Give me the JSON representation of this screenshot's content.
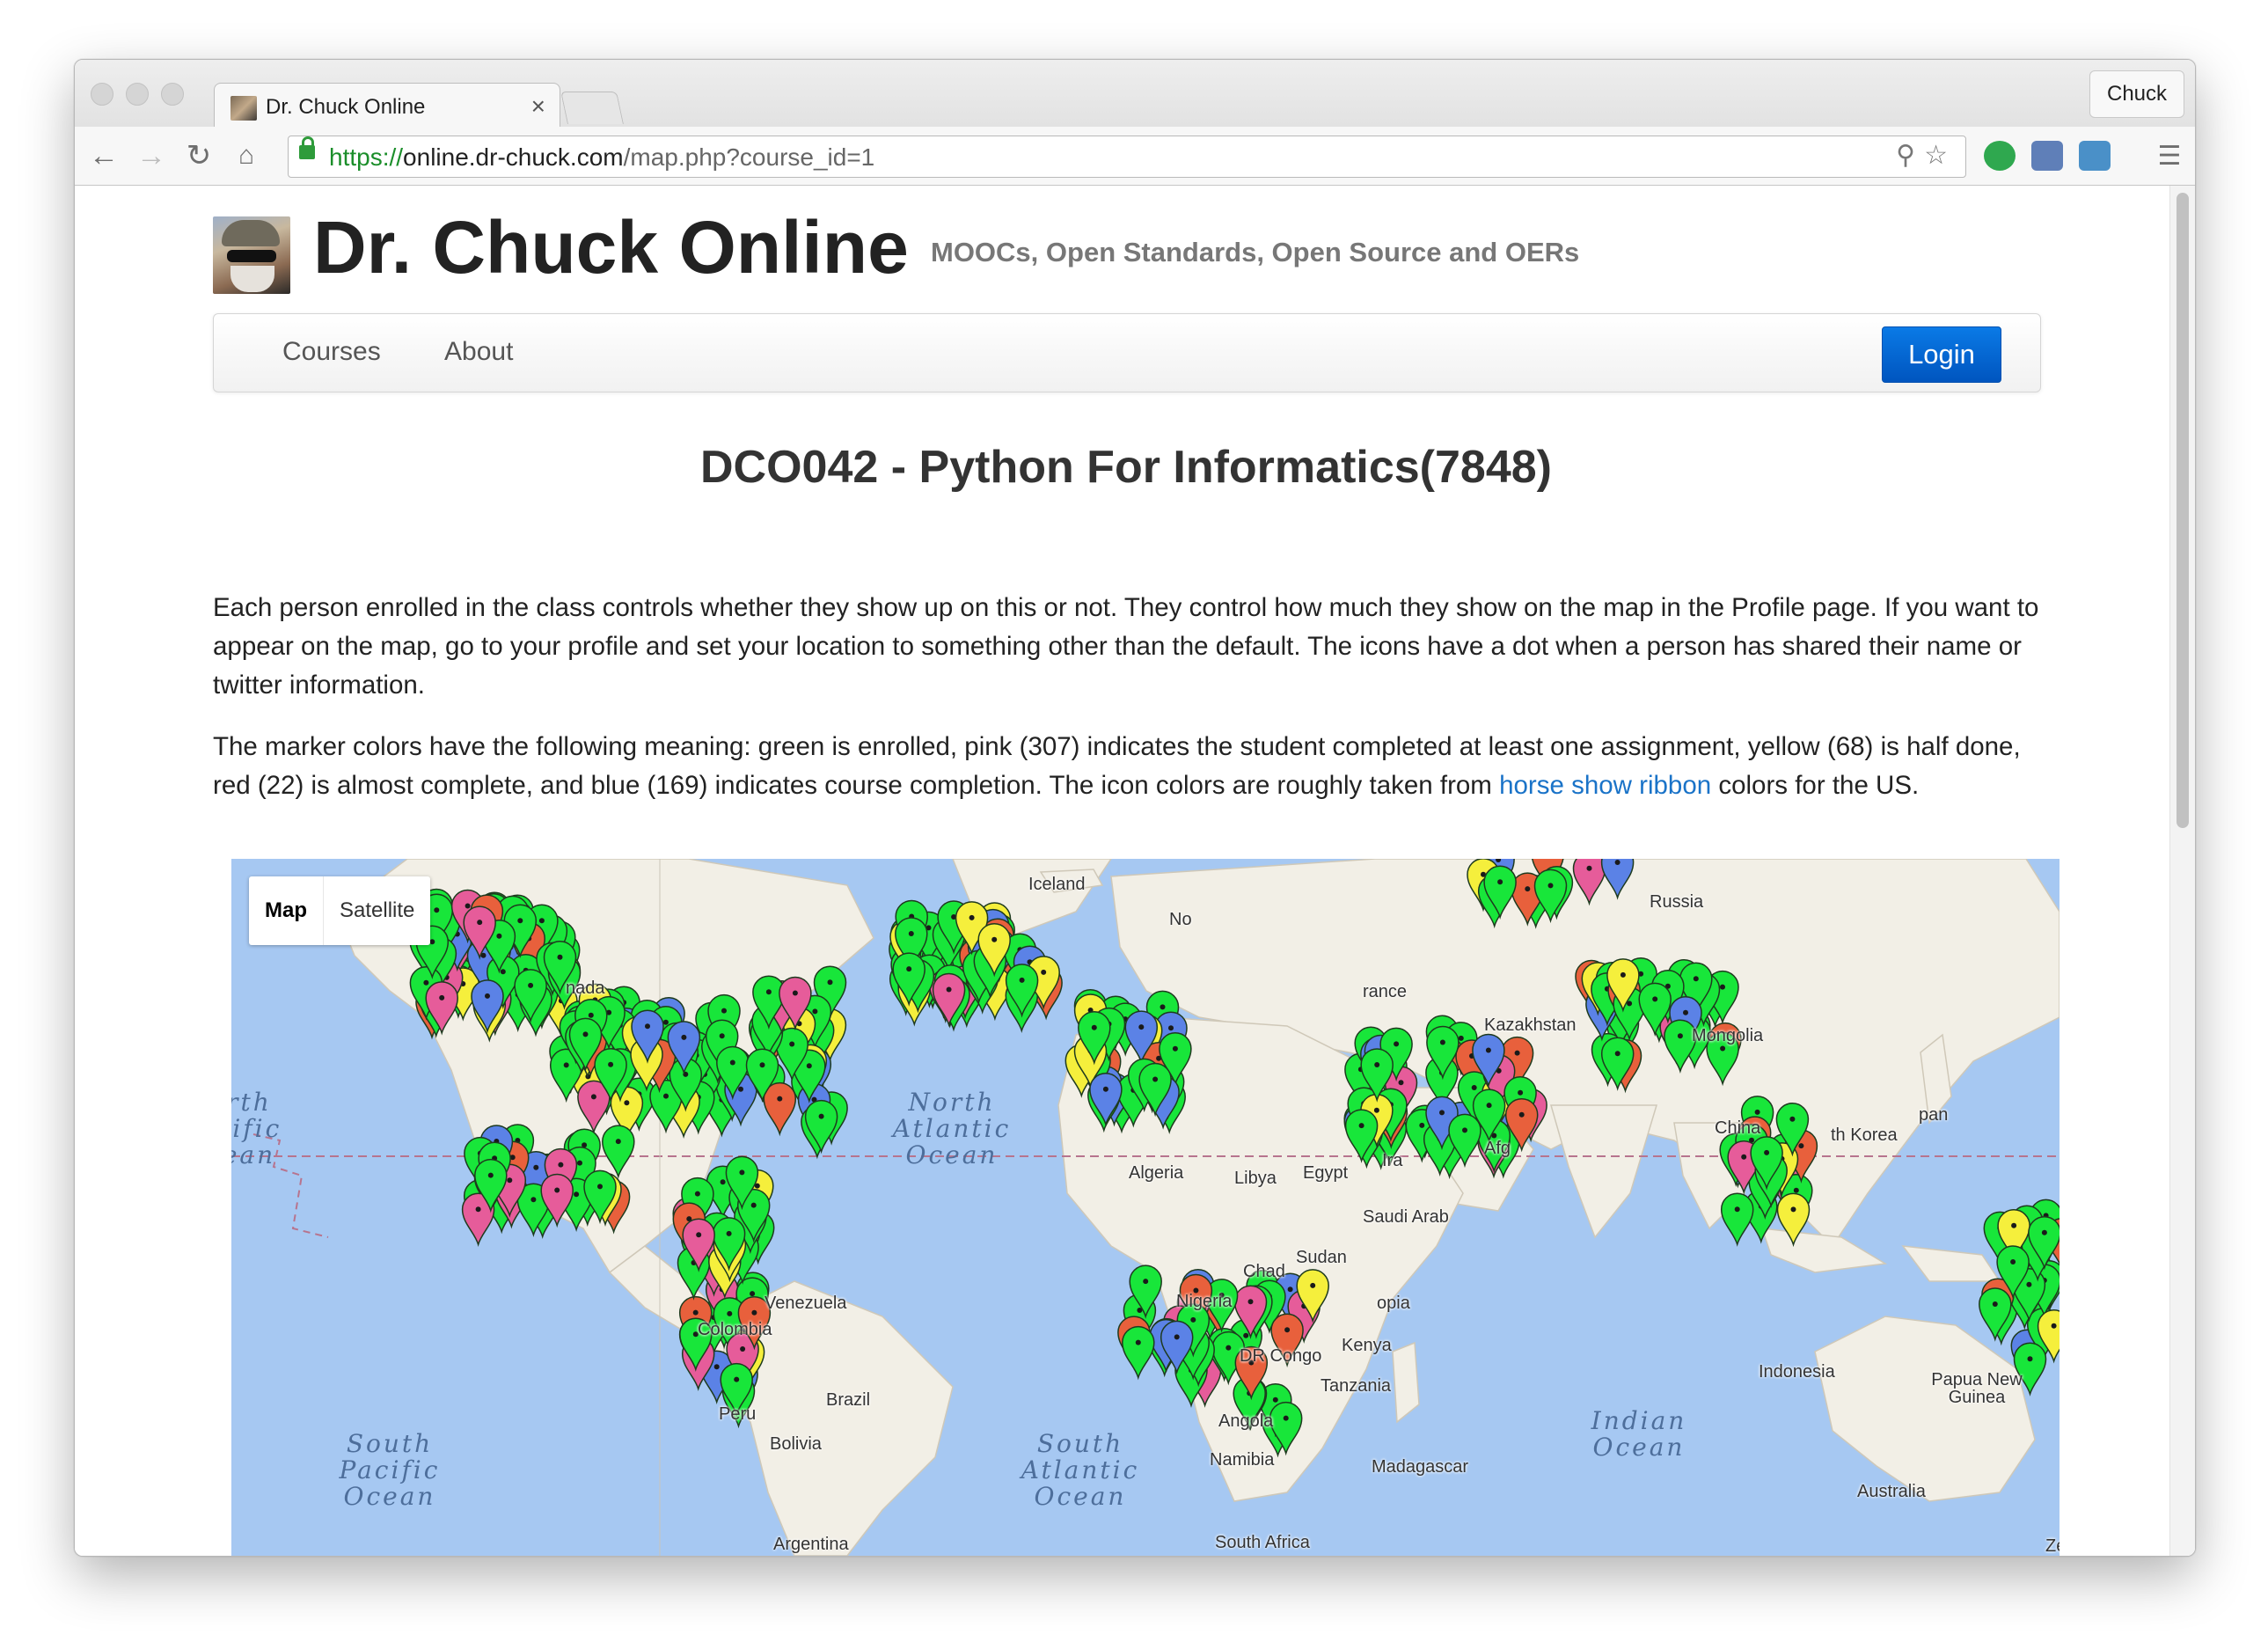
{
  "browser": {
    "tab_title": "Dr. Chuck Online",
    "tab_close": "×",
    "profile_name": "Chuck",
    "url_scheme": "https://",
    "url_host": "online.dr-chuck.com",
    "url_path": "/map.php?course_id=1",
    "nav_icons": {
      "back": "back-arrow-icon",
      "forward": "forward-arrow-icon",
      "reload": "reload-icon",
      "home": "home-icon"
    }
  },
  "site": {
    "title": "Dr. Chuck Online",
    "tagline": "MOOCs, Open Standards, Open Source and OERs"
  },
  "nav": {
    "items": [
      {
        "label": "Courses"
      },
      {
        "label": "About"
      }
    ],
    "login_label": "Login"
  },
  "course": {
    "title": "DCO042 - Python For Informatics(7848)"
  },
  "description": {
    "p1": "Each person enrolled in the class controls whether they show up on this or not. They control how much they show on the map in the Profile page. If you want to appear on the map, go to your profile and set your location to something other than the default. The icons have a dot when a person has shared their name or twitter information.",
    "p2_before": "The marker colors have the following meaning: green is enrolled, pink (307) indicates the student completed at least one assignment, yellow (68) is half done, red (22) is almost complete, and blue (169) indicates course completion. The icon colors are roughly taken from ",
    "p2_link": "horse show ribbon",
    "p2_after": " colors for the US."
  },
  "map": {
    "type_buttons": [
      {
        "label": "Map",
        "active": true
      },
      {
        "label": "Satellite",
        "active": false
      }
    ],
    "labels": {
      "iceland": "Iceland",
      "russia": "Russia",
      "kazakhstan": "Kazakhstan",
      "mongolia": "Mongolia",
      "china": "China",
      "algeria": "Algeria",
      "libya": "Libya",
      "egypt": "Egypt",
      "saudi": "Saudi Arab",
      "sudan": "Sudan",
      "chad": "Chad",
      "nigeria": "Nigeria",
      "ethiopia": "opia",
      "kenya": "Kenya",
      "drcongo": "DR Congo",
      "tanzania": "Tanzania",
      "angola": "Angola",
      "namibia": "Namibia",
      "madagascar": "Madagascar",
      "southafrica": "South Africa",
      "venezuela": "Venezuela",
      "colombia": "Colombia",
      "brazil": "Brazil",
      "peru": "Peru",
      "bolivia": "Bolivia",
      "argentina": "Argentina",
      "canada": "nada",
      "indonesia": "Indonesia",
      "png": "Papua New Guinea",
      "australia": "Australia",
      "japan": "pan",
      "korea": "th Korea",
      "afghanistan": "Afg",
      "iran": "Ira",
      "france": "rance",
      "norway": "No",
      "zoom": "Ze"
    },
    "oceans": {
      "north_atlantic": "North Atlantic Ocean",
      "south_atlantic": "South Atlantic Ocean",
      "south_pacific": "South Pacific Ocean",
      "north_pacific": "rth cific ean",
      "indian": "Indian Ocean"
    },
    "colors": {
      "water": "#a6c8f2",
      "land": "#f2efe6",
      "green_marker": "#18e63a",
      "pink_marker": "#e65c9a",
      "yellow_marker": "#f5ef3c",
      "red_marker": "#e8603c",
      "blue_marker": "#5b82e6"
    },
    "legend_counts": {
      "pink": 307,
      "yellow": 68,
      "red": 22,
      "blue": 169
    }
  }
}
